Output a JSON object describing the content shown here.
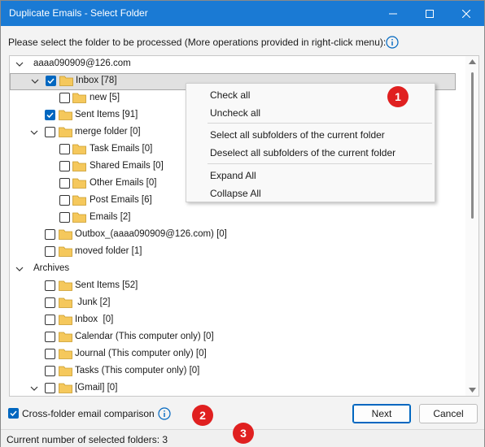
{
  "window": {
    "title": "Duplicate Emails - Select Folder"
  },
  "prompt": "Please select the folder to be processed (More operations provided in right-click menu):",
  "tree": {
    "rows": [
      {
        "label": "aaaa090909@126.com"
      },
      {
        "label": "Inbox [78]",
        "checked": true,
        "selected": true
      },
      {
        "label": "new [5]"
      },
      {
        "label": "Sent Items [91]",
        "checked": true
      },
      {
        "label": "merge folder [0]"
      },
      {
        "label": "Task Emails [0]"
      },
      {
        "label": "Shared Emails [0]"
      },
      {
        "label": "Other Emails [0]"
      },
      {
        "label": "Post Emails [6]"
      },
      {
        "label": "Emails [2]"
      },
      {
        "label": "Outbox_(aaaa090909@126.com) [0]"
      },
      {
        "label": "moved folder [1]"
      },
      {
        "label": "Archives"
      },
      {
        "label": "Sent Items [52]"
      },
      {
        "label": " Junk [2]"
      },
      {
        "label": "Inbox  [0]"
      },
      {
        "label": "Calendar (This computer only) [0]"
      },
      {
        "label": "Journal (This computer only) [0]"
      },
      {
        "label": "Tasks (This computer only) [0]"
      },
      {
        "label": "[Gmail] [0]"
      }
    ]
  },
  "context_menu": {
    "items": [
      "Check all",
      "Uncheck all",
      "Select all subfolders of the current folder",
      "Deselect all subfolders of the current folder",
      "Expand All",
      "Collapse All"
    ]
  },
  "badges": [
    "1",
    "2",
    "3"
  ],
  "footer": {
    "cross_folder_label": "Cross-folder email comparison",
    "cross_folder_checked": true,
    "next_label": "Next",
    "cancel_label": "Cancel"
  },
  "status": {
    "text": "Current number of selected folders: 3"
  },
  "colors": {
    "titlebar": "#1a7ad4",
    "accent": "#0067c0",
    "badge": "#e02020",
    "folder": "#f5c85c"
  }
}
